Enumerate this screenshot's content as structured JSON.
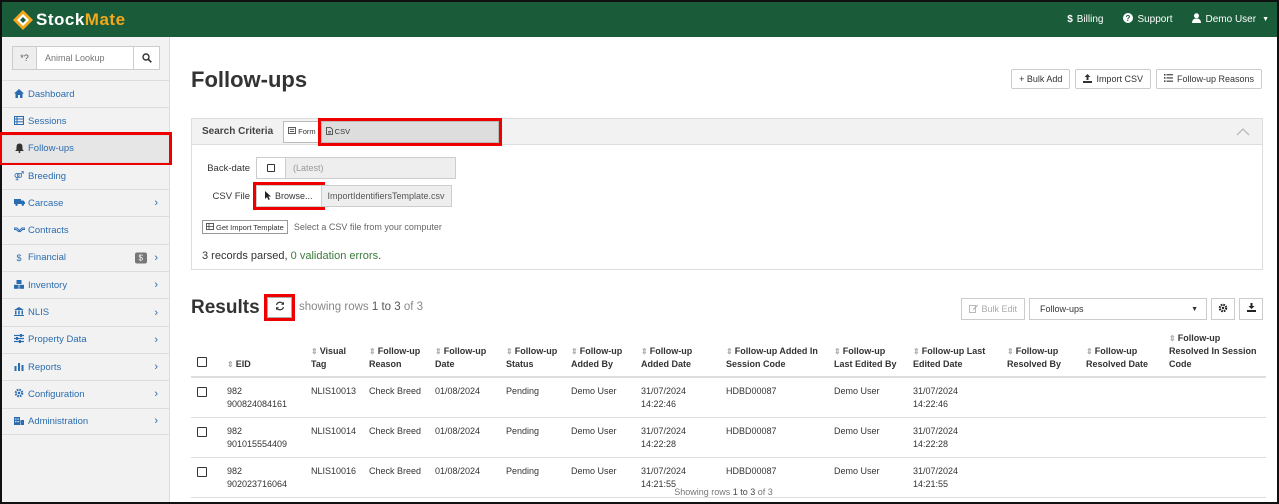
{
  "app": {
    "name": "StockMate",
    "brand_color": "#1a5c3a",
    "nav": [
      {
        "icon": "dollar-icon",
        "label": "Billing"
      },
      {
        "icon": "help-icon",
        "label": "Support"
      },
      {
        "icon": "user-icon",
        "label": "Demo User"
      }
    ]
  },
  "sidebar": {
    "lookup_prefix": "*?",
    "lookup_placeholder": "Animal Lookup",
    "items": [
      {
        "icon": "home-icon",
        "label": "Dashboard",
        "chevron": false
      },
      {
        "icon": "list-icon",
        "label": "Sessions",
        "chevron": false
      },
      {
        "icon": "bell-icon",
        "label": "Follow-ups",
        "chevron": false,
        "active": true
      },
      {
        "icon": "breeding-icon",
        "label": "Breeding",
        "chevron": false
      },
      {
        "icon": "truck-icon",
        "label": "Carcase",
        "chevron": true
      },
      {
        "icon": "handshake-icon",
        "label": "Contracts",
        "chevron": false
      },
      {
        "icon": "dollar-icon",
        "label": "Financial",
        "chevron": true,
        "badge": "$"
      },
      {
        "icon": "cubes-icon",
        "label": "Inventory",
        "chevron": true
      },
      {
        "icon": "building-icon",
        "label": "NLIS",
        "chevron": true
      },
      {
        "icon": "sliders-icon",
        "label": "Property Data",
        "chevron": true
      },
      {
        "icon": "bar-chart-icon",
        "label": "Reports",
        "chevron": true
      },
      {
        "icon": "gear-icon",
        "label": "Configuration",
        "chevron": true
      },
      {
        "icon": "building-icon",
        "label": "Administration",
        "chevron": true
      }
    ]
  },
  "page": {
    "title": "Follow-ups",
    "buttons": [
      "+ Bulk Add",
      "Import CSV",
      "Follow-up Reasons"
    ]
  },
  "criteria": {
    "title": "Search Criteria",
    "modes": [
      "Form",
      "CSV"
    ],
    "selected_mode": "CSV",
    "backdate_label": "Back-date",
    "backdate_value": "(Latest)",
    "csv_label": "CSV File",
    "browse_label": "Browse...",
    "file_name": "ImportIdentifiersTemplate.csv",
    "template_button": "Get Import Template",
    "hint": "Select a CSV file from your computer",
    "parsed_prefix": "3 records parsed, ",
    "parsed_errors": "0 validation errors",
    "parsed_suffix": "."
  },
  "results": {
    "title": "Results",
    "showing_prefix": "showing rows ",
    "showing_range": "1 to 3",
    "showing_suffix": " of 3",
    "bulk_edit": "Bulk Edit",
    "view_select": "Follow-ups",
    "footer_prefix": "Showing rows ",
    "footer_range": "1 to 3",
    "footer_suffix": " of 3"
  },
  "table": {
    "columns": [
      "EID",
      "Visual Tag",
      "Follow-up Reason",
      "Follow-up Date",
      "Follow-up Status",
      "Follow-up Added By",
      "Follow-up Added Date",
      "Follow-up Added In Session Code",
      "Follow-up Last Edited By",
      "Follow-up Last Edited Date",
      "Follow-up Resolved By",
      "Follow-up Resolved Date",
      "Follow-up Resolved In Session Code"
    ],
    "rows": [
      [
        "982 900824084161",
        "NLIS10013",
        "Check Breed",
        "01/08/2024",
        "Pending",
        "Demo User",
        "31/07/2024 14:22:46",
        "HDBD00087",
        "Demo User",
        "31/07/2024 14:22:46",
        "",
        "",
        ""
      ],
      [
        "982 901015554409",
        "NLIS10014",
        "Check Breed",
        "01/08/2024",
        "Pending",
        "Demo User",
        "31/07/2024 14:22:28",
        "HDBD00087",
        "Demo User",
        "31/07/2024 14:22:28",
        "",
        "",
        ""
      ],
      [
        "982 902023716064",
        "NLIS10016",
        "Check Breed",
        "01/08/2024",
        "Pending",
        "Demo User",
        "31/07/2024 14:21:55",
        "HDBD00087",
        "Demo User",
        "31/07/2024 14:21:55",
        "",
        "",
        ""
      ]
    ]
  }
}
